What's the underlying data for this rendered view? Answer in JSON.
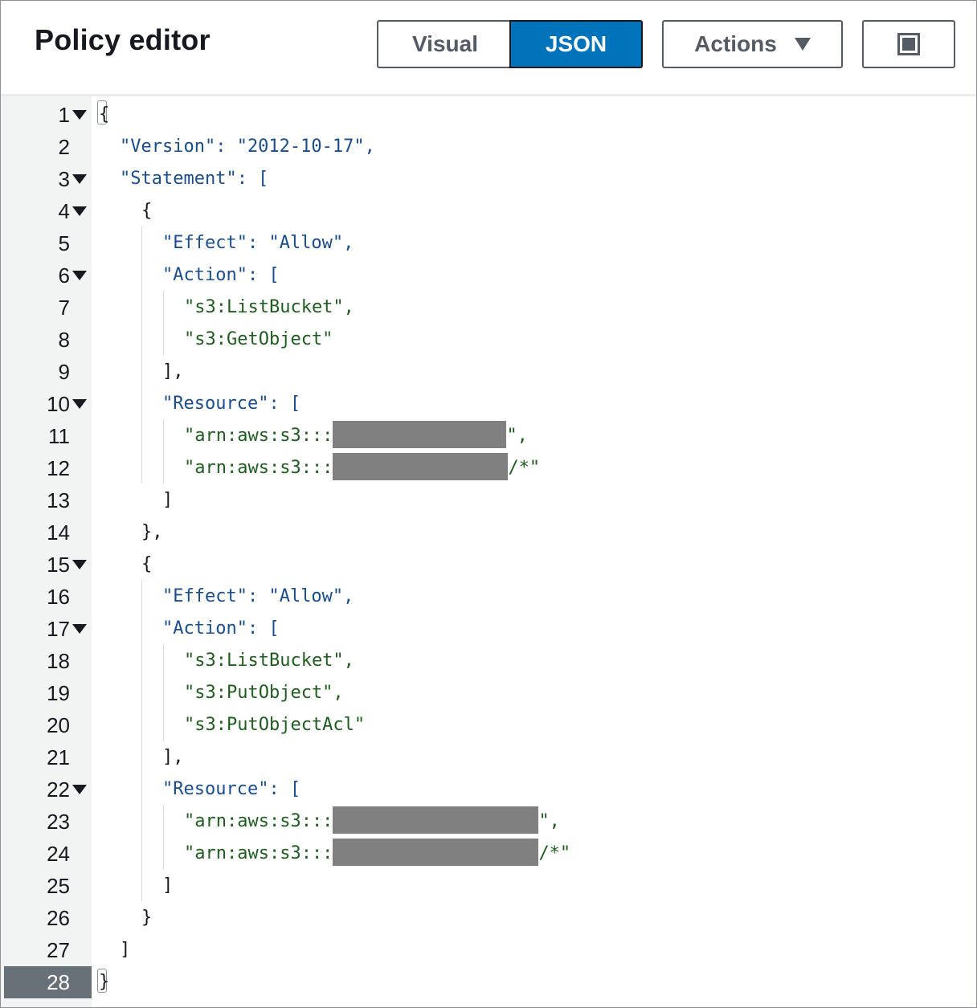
{
  "header": {
    "title": "Policy editor",
    "visual_label": "Visual",
    "json_label": "JSON",
    "actions_label": "Actions"
  },
  "icons": {
    "actions_caret": "caret-down-icon",
    "fullscreen": "fullscreen-icon",
    "fold": "fold-arrow-icon"
  },
  "colors": {
    "accent": "#0073bb",
    "key": "#1a4d8f",
    "string": "#1f5d1f",
    "redaction": "#808080",
    "active_line": "#687078"
  },
  "editor": {
    "active_line": 28,
    "lines": [
      {
        "n": "1",
        "text": "{"
      },
      {
        "n": "2",
        "text": "\"Version\": \"2012-10-17\","
      },
      {
        "n": "3",
        "text": "\"Statement\": ["
      },
      {
        "n": "4",
        "text": "{"
      },
      {
        "n": "5",
        "text": "\"Effect\": \"Allow\","
      },
      {
        "n": "6",
        "text": "\"Action\": ["
      },
      {
        "n": "7",
        "text": "\"s3:ListBucket\","
      },
      {
        "n": "8",
        "text": "\"s3:GetObject\""
      },
      {
        "n": "9",
        "text": "],"
      },
      {
        "n": "10",
        "text": "\"Resource\": ["
      },
      {
        "n": "11",
        "prefix": "\"arn:aws:s3:::",
        "suffix": "\","
      },
      {
        "n": "12",
        "prefix": "\"arn:aws:s3:::",
        "suffix": "/*\""
      },
      {
        "n": "13",
        "text": "]"
      },
      {
        "n": "14",
        "text": "},"
      },
      {
        "n": "15",
        "text": "{"
      },
      {
        "n": "16",
        "text": "\"Effect\": \"Allow\","
      },
      {
        "n": "17",
        "text": "\"Action\": ["
      },
      {
        "n": "18",
        "text": "\"s3:ListBucket\","
      },
      {
        "n": "19",
        "text": "\"s3:PutObject\","
      },
      {
        "n": "20",
        "text": "\"s3:PutObjectAcl\""
      },
      {
        "n": "21",
        "text": "],"
      },
      {
        "n": "22",
        "text": "\"Resource\": ["
      },
      {
        "n": "23",
        "prefix": "\"arn:aws:s3:::",
        "suffix": "\","
      },
      {
        "n": "24",
        "prefix": "\"arn:aws:s3:::",
        "suffix": "/*\""
      },
      {
        "n": "25",
        "text": "]"
      },
      {
        "n": "26",
        "text": "}"
      },
      {
        "n": "27",
        "text": "]"
      },
      {
        "n": "28",
        "text": "}"
      }
    ]
  }
}
